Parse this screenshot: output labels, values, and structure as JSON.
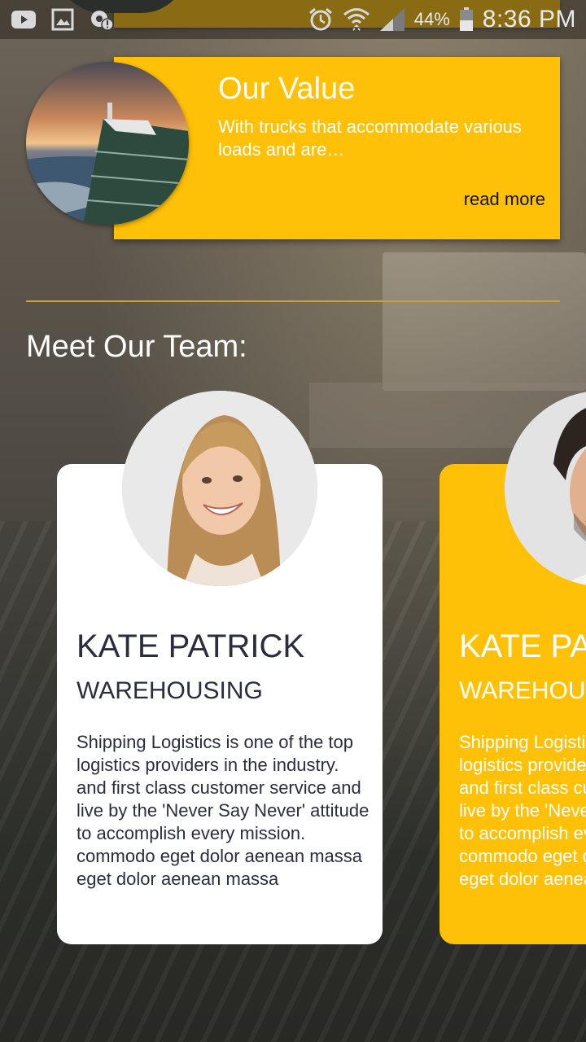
{
  "status_bar": {
    "battery_percent": "44%",
    "time": "8:36 PM",
    "left_icons": [
      "youtube-icon",
      "gallery-icon",
      "alert-settings-icon"
    ],
    "right_icons": [
      "alarm-icon",
      "wifi-icon",
      "signal-icon",
      "battery-icon"
    ]
  },
  "value_card": {
    "title": "Our Value",
    "description": "With trucks that accommodate various loads and are…",
    "read_more": "read more"
  },
  "team": {
    "heading": "Meet Our Team:",
    "members": [
      {
        "name": "KATE PATRICK",
        "role": "WAREHOUSING",
        "bio": "Shipping Logistics is one of the top logistics providers in the industry. and first class customer service and live by the 'Never Say Never' attitude to accomplish every mission. commodo eget dolor aenean massa eget dolor aenean massa"
      },
      {
        "name": "KATE PATRICK",
        "role": "WAREHOUSING",
        "bio": "Shipping Logistics is one of the top logistics providers in the industry. and first class customer service and live by the 'Never Say Never' attitude to accomplish every mission. commodo eget dolor aenean massa eget dolor aenean massa"
      }
    ]
  },
  "colors": {
    "accent": "#ffc107",
    "card_text": "#2b2d3e",
    "divider": "#c8a23c"
  }
}
